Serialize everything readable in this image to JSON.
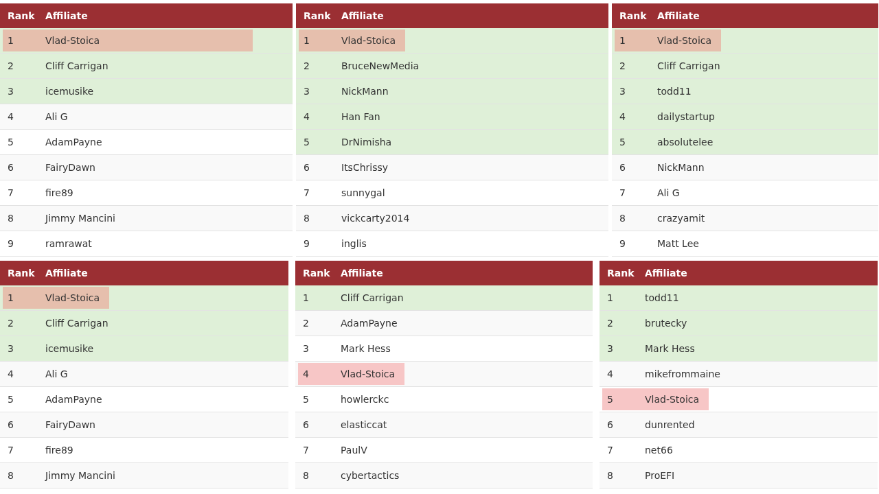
{
  "tables": [
    {
      "columns": [
        "Rank",
        "Affiliate"
      ],
      "rows": [
        {
          "rank": "1",
          "name": "Vlad-Stoica",
          "top": true,
          "highlight": true
        },
        {
          "rank": "2",
          "name": "Cliff Carrigan",
          "top": true,
          "highlight": false
        },
        {
          "rank": "3",
          "name": "icemusike",
          "top": true,
          "highlight": false
        },
        {
          "rank": "4",
          "name": "Ali G",
          "top": false,
          "highlight": false
        },
        {
          "rank": "5",
          "name": "AdamPayne",
          "top": false,
          "highlight": false
        },
        {
          "rank": "6",
          "name": "FairyDawn",
          "top": false,
          "highlight": false
        },
        {
          "rank": "7",
          "name": "fire89",
          "top": false,
          "highlight": false
        },
        {
          "rank": "8",
          "name": "Jimmy Mancini",
          "top": false,
          "highlight": false
        },
        {
          "rank": "9",
          "name": "ramrawat",
          "top": false,
          "highlight": false
        }
      ]
    },
    {
      "columns": [
        "Rank",
        "Affiliate"
      ],
      "rows": [
        {
          "rank": "1",
          "name": "Vlad-Stoica",
          "top": true,
          "highlight": true
        },
        {
          "rank": "2",
          "name": "BruceNewMedia",
          "top": true,
          "highlight": false
        },
        {
          "rank": "3",
          "name": "NickMann",
          "top": true,
          "highlight": false
        },
        {
          "rank": "4",
          "name": "Han Fan",
          "top": true,
          "highlight": false
        },
        {
          "rank": "5",
          "name": "DrNimisha",
          "top": true,
          "highlight": false
        },
        {
          "rank": "6",
          "name": "ItsChrissy",
          "top": false,
          "highlight": false
        },
        {
          "rank": "7",
          "name": "sunnygal",
          "top": false,
          "highlight": false
        },
        {
          "rank": "8",
          "name": "vickcarty2014",
          "top": false,
          "highlight": false
        },
        {
          "rank": "9",
          "name": "inglis",
          "top": false,
          "highlight": false
        }
      ]
    },
    {
      "columns": [
        "Rank",
        "Affiliate"
      ],
      "rows": [
        {
          "rank": "1",
          "name": "Vlad-Stoica",
          "top": true,
          "highlight": true
        },
        {
          "rank": "2",
          "name": "Cliff Carrigan",
          "top": true,
          "highlight": false
        },
        {
          "rank": "3",
          "name": "todd11",
          "top": true,
          "highlight": false
        },
        {
          "rank": "4",
          "name": "dailystartup",
          "top": true,
          "highlight": false
        },
        {
          "rank": "5",
          "name": "absolutelee",
          "top": true,
          "highlight": false
        },
        {
          "rank": "6",
          "name": "NickMann",
          "top": false,
          "highlight": false
        },
        {
          "rank": "7",
          "name": "Ali G",
          "top": false,
          "highlight": false
        },
        {
          "rank": "8",
          "name": "crazyamit",
          "top": false,
          "highlight": false
        },
        {
          "rank": "9",
          "name": "Matt Lee",
          "top": false,
          "highlight": false
        }
      ]
    },
    {
      "columns": [
        "Rank",
        "Affiliate"
      ],
      "rows": [
        {
          "rank": "1",
          "name": "Vlad-Stoica",
          "top": true,
          "highlight": true
        },
        {
          "rank": "2",
          "name": "Cliff Carrigan",
          "top": true,
          "highlight": false
        },
        {
          "rank": "3",
          "name": "icemusike",
          "top": true,
          "highlight": false
        },
        {
          "rank": "4",
          "name": "Ali G",
          "top": false,
          "highlight": false
        },
        {
          "rank": "5",
          "name": "AdamPayne",
          "top": false,
          "highlight": false
        },
        {
          "rank": "6",
          "name": "FairyDawn",
          "top": false,
          "highlight": false
        },
        {
          "rank": "7",
          "name": "fire89",
          "top": false,
          "highlight": false
        },
        {
          "rank": "8",
          "name": "Jimmy Mancini",
          "top": false,
          "highlight": false
        }
      ]
    },
    {
      "columns": [
        "Rank",
        "Affiliate"
      ],
      "rows": [
        {
          "rank": "1",
          "name": "Cliff Carrigan",
          "top": true,
          "highlight": false
        },
        {
          "rank": "2",
          "name": "AdamPayne",
          "top": false,
          "highlight": false
        },
        {
          "rank": "3",
          "name": "Mark Hess",
          "top": false,
          "highlight": false
        },
        {
          "rank": "4",
          "name": "Vlad-Stoica",
          "top": false,
          "highlight": true
        },
        {
          "rank": "5",
          "name": "howlerckc",
          "top": false,
          "highlight": false
        },
        {
          "rank": "6",
          "name": "elasticcat",
          "top": false,
          "highlight": false
        },
        {
          "rank": "7",
          "name": "PaulV",
          "top": false,
          "highlight": false
        },
        {
          "rank": "8",
          "name": "cybertactics",
          "top": false,
          "highlight": false
        }
      ]
    },
    {
      "columns": [
        "Rank",
        "Affiliate"
      ],
      "rows": [
        {
          "rank": "1",
          "name": "todd11",
          "top": true,
          "highlight": false
        },
        {
          "rank": "2",
          "name": "brutecky",
          "top": true,
          "highlight": false
        },
        {
          "rank": "3",
          "name": "Mark Hess",
          "top": true,
          "highlight": false
        },
        {
          "rank": "4",
          "name": "mikefrommaine",
          "top": false,
          "highlight": false
        },
        {
          "rank": "5",
          "name": "Vlad-Stoica",
          "top": false,
          "highlight": true
        },
        {
          "rank": "6",
          "name": "dunrented",
          "top": false,
          "highlight": false
        },
        {
          "rank": "7",
          "name": "net66",
          "top": false,
          "highlight": false
        },
        {
          "rank": "8",
          "name": "ProEFI",
          "top": false,
          "highlight": false
        }
      ]
    }
  ]
}
